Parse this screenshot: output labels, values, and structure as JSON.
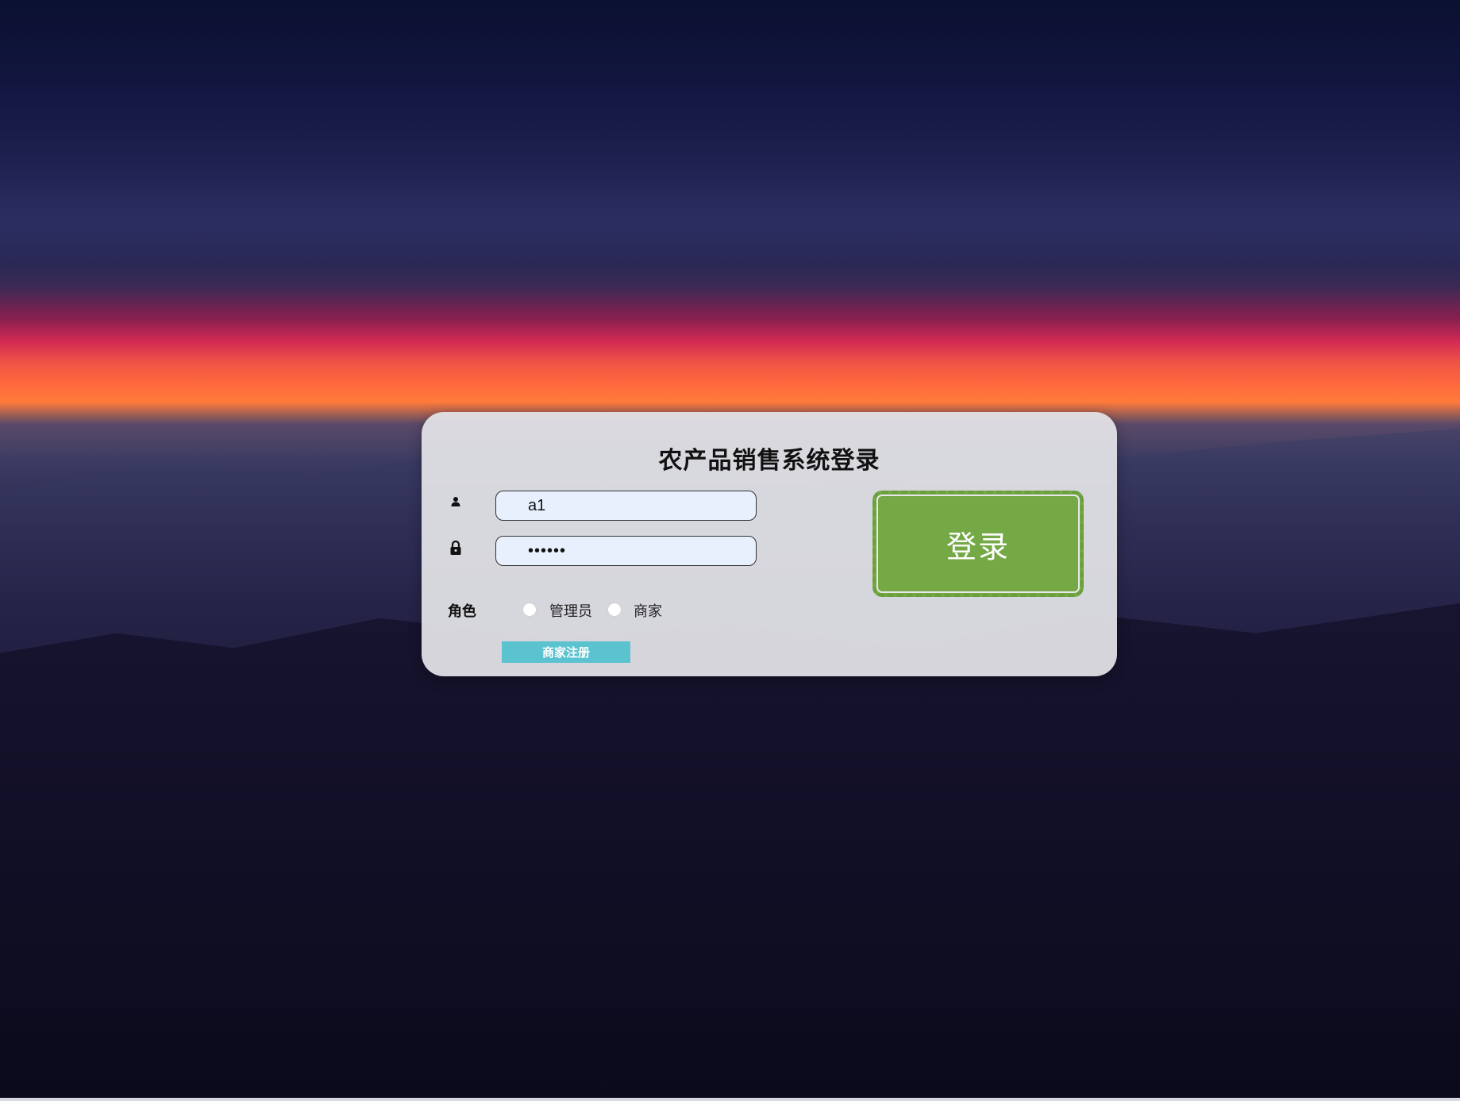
{
  "page": {
    "title": "农产品销售系统登录"
  },
  "form": {
    "username_value": "a1",
    "password_value": "••••••",
    "role_label": "角色",
    "role_options": [
      {
        "label": "管理员",
        "selected": false
      },
      {
        "label": "商家",
        "selected": false
      }
    ],
    "login_label": "登录",
    "register_label": "商家注册"
  },
  "icons": {
    "user": "user-icon",
    "lock": "lock-icon"
  },
  "colors": {
    "login_button": "#74a946",
    "register_button": "#5bc2cf",
    "input_background": "#e8f0fe"
  }
}
